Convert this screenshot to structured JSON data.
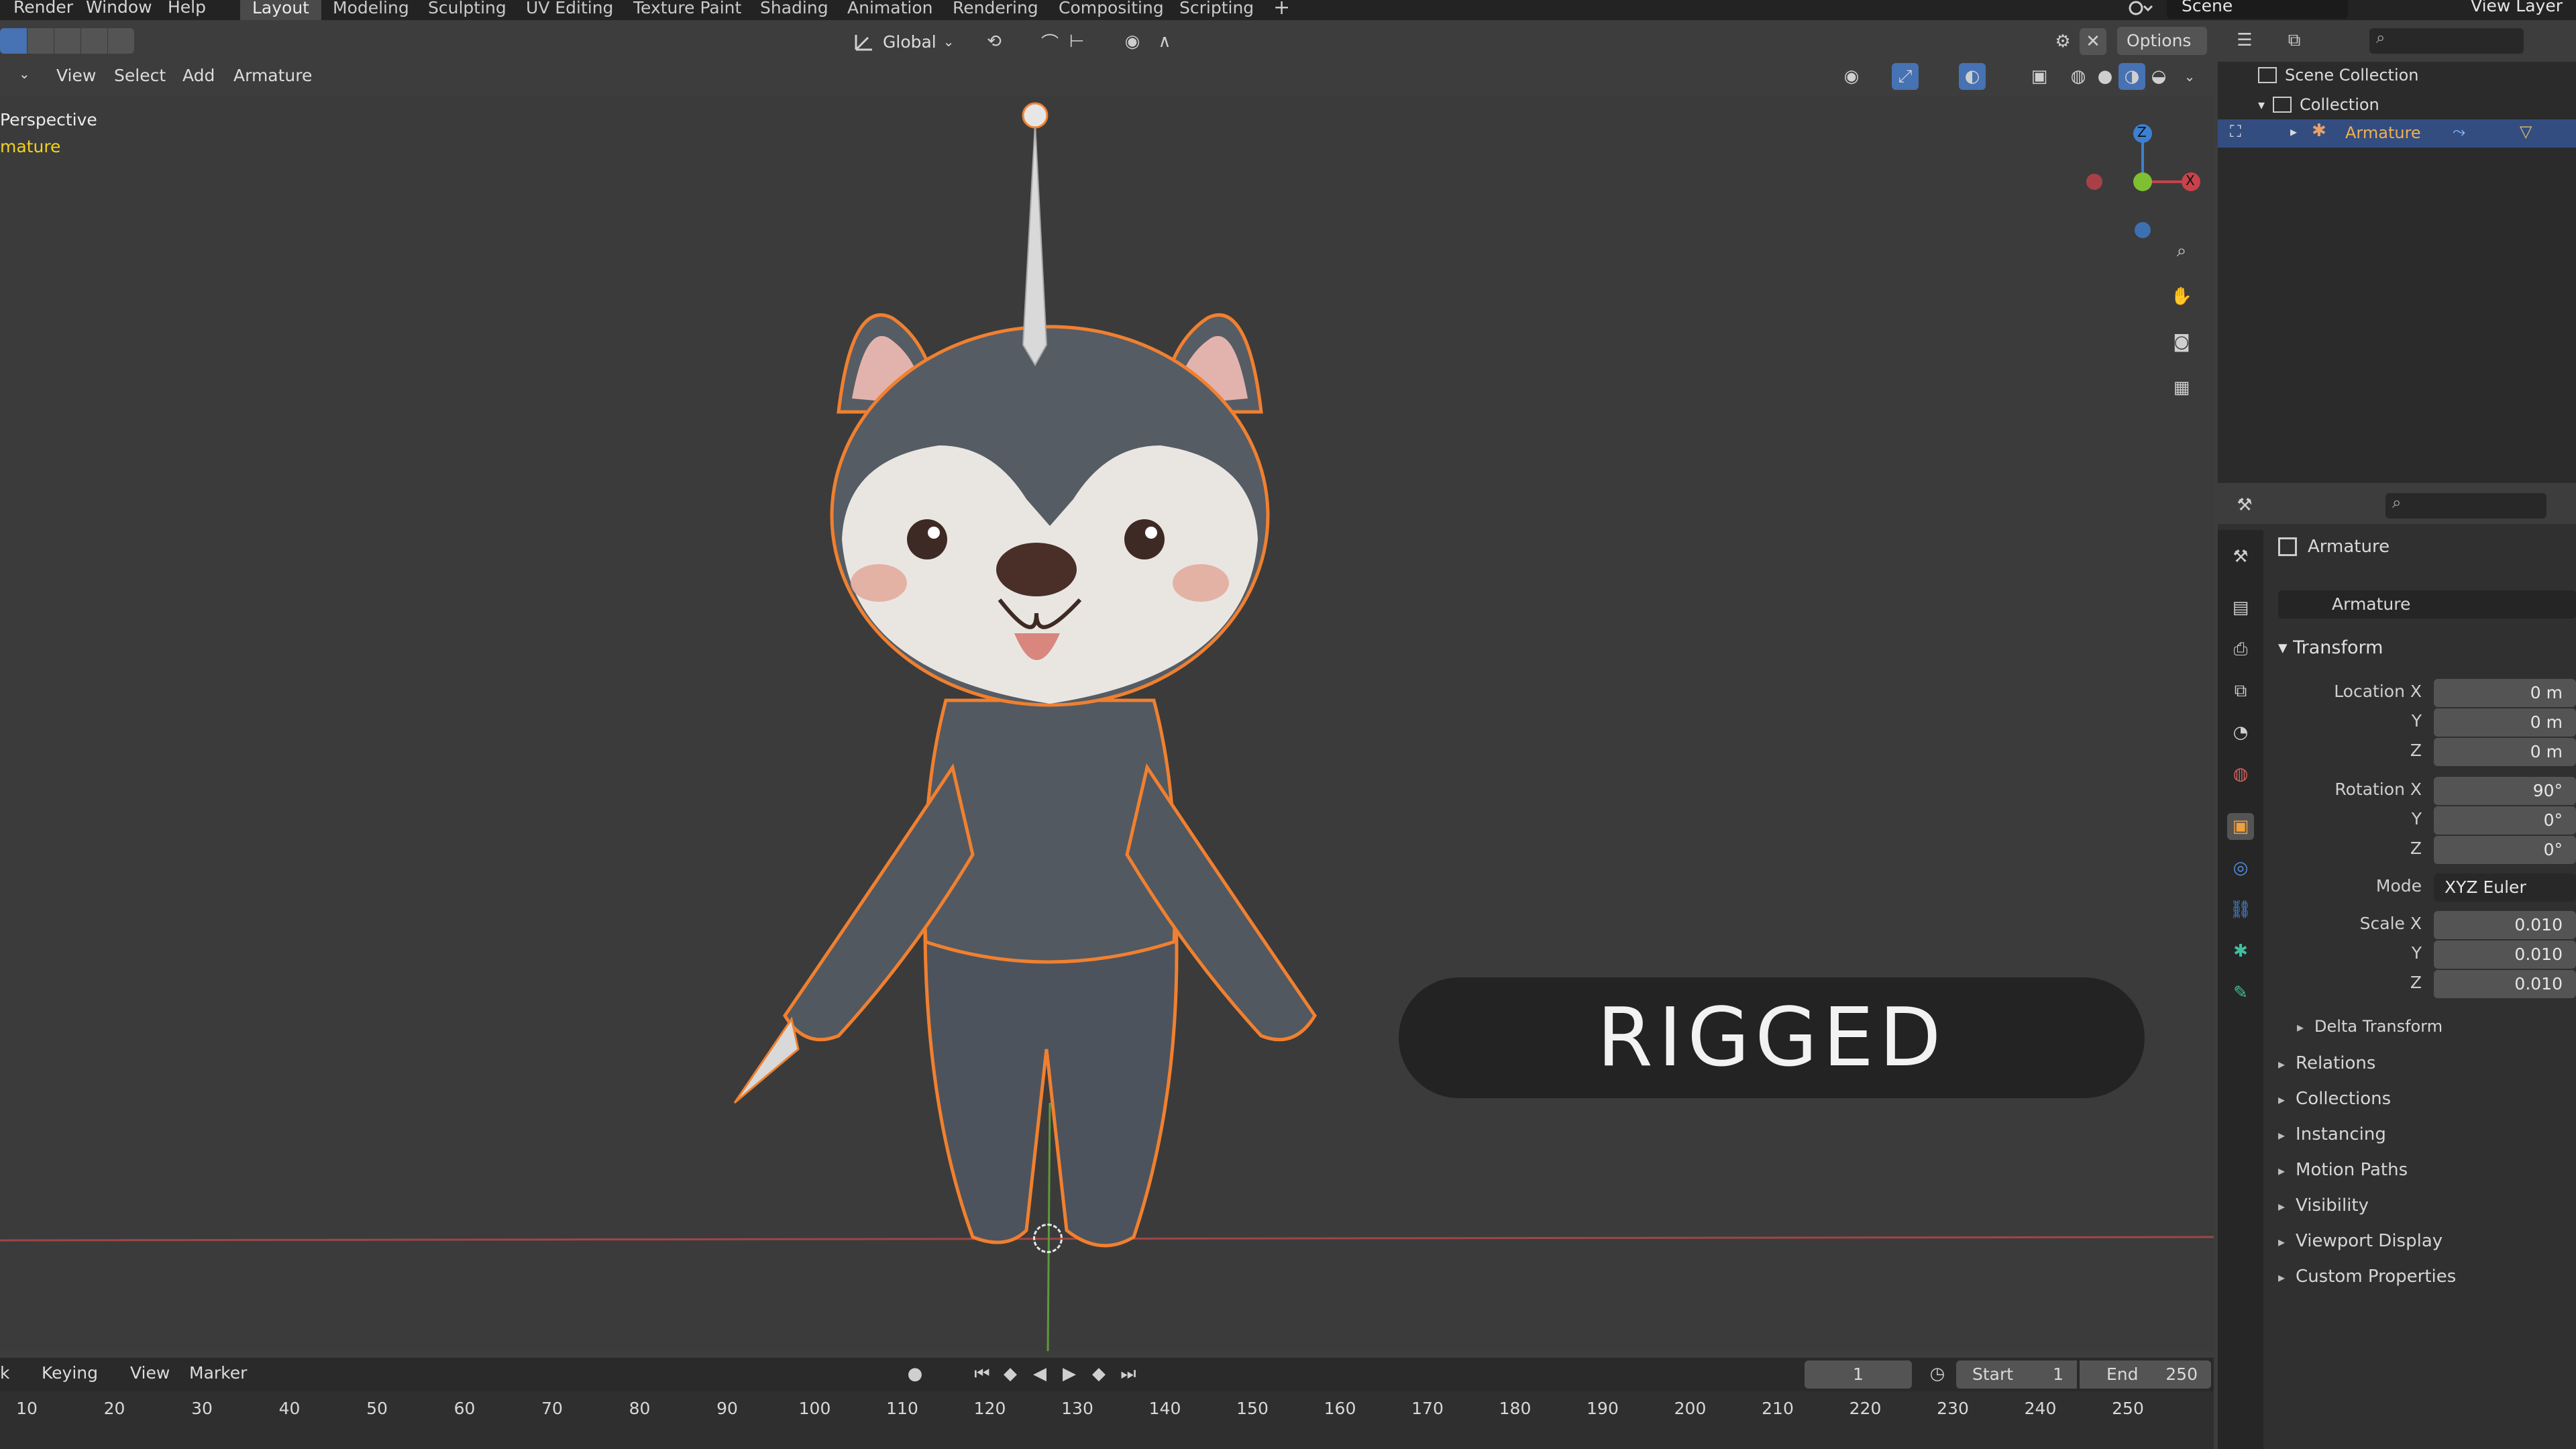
{
  "top_menu": [
    "Render",
    "Window",
    "Help"
  ],
  "workspace_tabs": [
    "Layout",
    "Modeling",
    "Sculpting",
    "UV Editing",
    "Texture Paint",
    "Shading",
    "Animation",
    "Rendering",
    "Compositing",
    "Scripting"
  ],
  "active_workspace": "Layout",
  "scene_name": "Scene",
  "view_layer": "View Layer",
  "viewport": {
    "orientation": "Global",
    "options_label": "Options",
    "menus": [
      "View",
      "Select",
      "Add",
      "Armature"
    ],
    "overlay_title": "Perspective",
    "overlay_object": "mature",
    "banner": "RIGGED"
  },
  "gizmo": {
    "z": "Z",
    "x": "X"
  },
  "outliner": {
    "scene_collection": "Scene Collection",
    "collection": "Collection",
    "armature": "Armature"
  },
  "properties": {
    "object_name": "Armature",
    "datablock": "Armature",
    "transform_header": "Transform",
    "location_label": "Location X",
    "location": [
      "0 m",
      "0 m",
      "0 m"
    ],
    "rotation_label": "Rotation X",
    "rotation": [
      "90°",
      "0°",
      "0°"
    ],
    "mode_label": "Mode",
    "mode_value": "XYZ Euler",
    "scale_label": "Scale X",
    "scale": [
      "0.010",
      "0.010",
      "0.010"
    ],
    "axis_y": "Y",
    "axis_z": "Z",
    "delta_transform": "Delta Transform",
    "panels": [
      "Relations",
      "Collections",
      "Instancing",
      "Motion Paths",
      "Visibility",
      "Viewport Display",
      "Custom Properties"
    ]
  },
  "timeline": {
    "menus": [
      "k",
      "Keying",
      "View",
      "Marker"
    ],
    "current_frame": "1",
    "start_label": "Start",
    "start": "1",
    "end_label": "End",
    "end": "250",
    "ticks": [
      "10",
      "20",
      "30",
      "40",
      "50",
      "60",
      "70",
      "80",
      "90",
      "100",
      "110",
      "120",
      "130",
      "140",
      "150",
      "160",
      "170",
      "180",
      "190",
      "200",
      "210",
      "220",
      "230",
      "240",
      "250"
    ]
  },
  "colors": {
    "accent_blue": "#4772b3",
    "selection_orange": "#f08030",
    "axis_red": "#c7424b",
    "axis_green": "#7ec030",
    "axis_blue": "#3c80d0"
  }
}
